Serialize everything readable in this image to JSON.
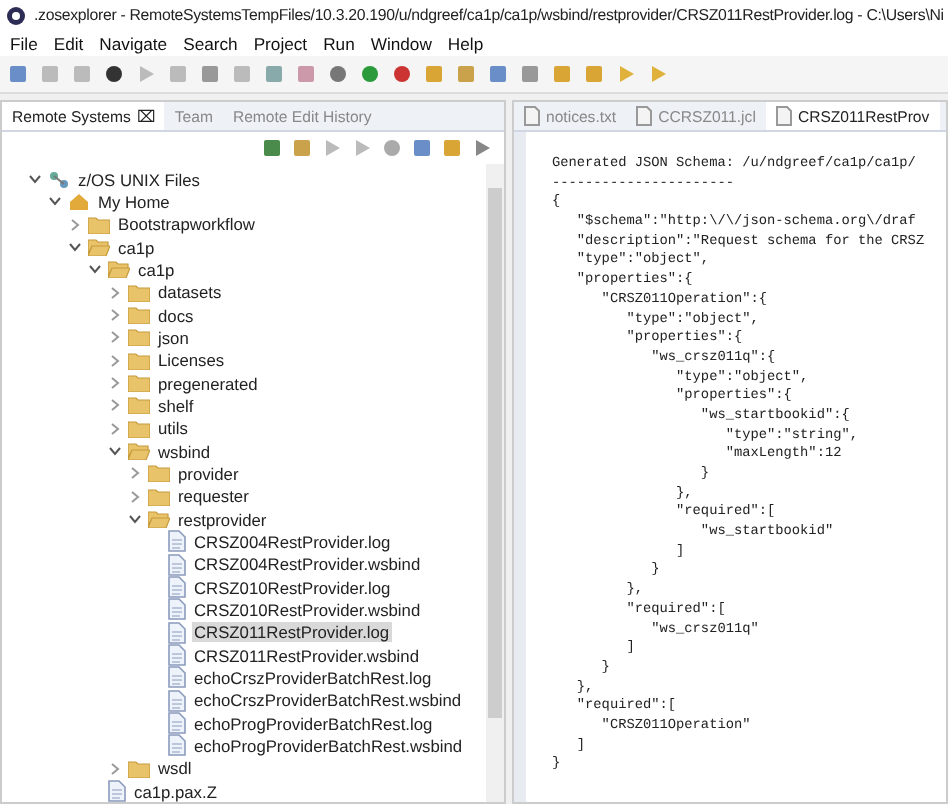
{
  "window": {
    "title": ".zosexplorer - RemoteSystemsTempFiles/10.3.20.190/u/ndgreef/ca1p/ca1p/wsbind/restprovider/CRSZ011RestProvider.log - C:\\Users\\Ni"
  },
  "menu": [
    "File",
    "Edit",
    "Navigate",
    "Search",
    "Project",
    "Run",
    "Window",
    "Help"
  ],
  "view_tabs": [
    {
      "label": "Remote Systems",
      "selected": true,
      "close": "⌧"
    },
    {
      "label": "Team",
      "selected": false
    },
    {
      "label": "Remote Edit History",
      "selected": false
    }
  ],
  "editor_tabs": [
    {
      "label": "notices.txt",
      "selected": false
    },
    {
      "label": "CCRSZ011.jcl",
      "selected": false
    },
    {
      "label": "CRSZ011RestProv",
      "selected": true
    }
  ],
  "tree": [
    {
      "label": "z/OS UNIX Files",
      "kind": "system",
      "expanded": true,
      "children": [
        {
          "label": "My Home",
          "kind": "home",
          "expanded": true,
          "children": [
            {
              "label": "Bootstrapworkflow",
              "kind": "folder",
              "expanded": false
            },
            {
              "label": "ca1p",
              "kind": "folder",
              "expanded": true,
              "children": [
                {
                  "label": "ca1p",
                  "kind": "folder",
                  "expanded": true,
                  "children": [
                    {
                      "label": "datasets",
                      "kind": "folder",
                      "expanded": false
                    },
                    {
                      "label": "docs",
                      "kind": "folder",
                      "expanded": false
                    },
                    {
                      "label": "json",
                      "kind": "folder",
                      "expanded": false
                    },
                    {
                      "label": "Licenses",
                      "kind": "folder",
                      "expanded": false
                    },
                    {
                      "label": "pregenerated",
                      "kind": "folder",
                      "expanded": false
                    },
                    {
                      "label": "shelf",
                      "kind": "folder",
                      "expanded": false
                    },
                    {
                      "label": "utils",
                      "kind": "folder",
                      "expanded": false
                    },
                    {
                      "label": "wsbind",
                      "kind": "folder",
                      "expanded": true,
                      "children": [
                        {
                          "label": "provider",
                          "kind": "folder",
                          "expanded": false
                        },
                        {
                          "label": "requester",
                          "kind": "folder",
                          "expanded": false
                        },
                        {
                          "label": "restprovider",
                          "kind": "folder",
                          "expanded": true,
                          "children": [
                            {
                              "label": "CRSZ004RestProvider.log",
                              "kind": "file",
                              "selected": false
                            },
                            {
                              "label": "CRSZ004RestProvider.wsbind",
                              "kind": "file",
                              "selected": false
                            },
                            {
                              "label": "CRSZ010RestProvider.log",
                              "kind": "file",
                              "selected": false
                            },
                            {
                              "label": "CRSZ010RestProvider.wsbind",
                              "kind": "file",
                              "selected": false
                            },
                            {
                              "label": "CRSZ011RestProvider.log",
                              "kind": "file",
                              "selected": true
                            },
                            {
                              "label": "CRSZ011RestProvider.wsbind",
                              "kind": "file",
                              "selected": false
                            },
                            {
                              "label": "echoCrszProviderBatchRest.log",
                              "kind": "file",
                              "selected": false
                            },
                            {
                              "label": "echoCrszProviderBatchRest.wsbind",
                              "kind": "file",
                              "selected": false
                            },
                            {
                              "label": "echoProgProviderBatchRest.log",
                              "kind": "file",
                              "selected": false
                            },
                            {
                              "label": "echoProgProviderBatchRest.wsbind",
                              "kind": "file",
                              "selected": false
                            }
                          ]
                        }
                      ]
                    },
                    {
                      "label": "wsdl",
                      "kind": "folder",
                      "expanded": false
                    }
                  ]
                },
                {
                  "label": "ca1p.pax.Z",
                  "kind": "file",
                  "selected": false
                }
              ]
            }
          ]
        }
      ]
    }
  ],
  "editor_lines": [
    "Generated JSON Schema: /u/ndgreef/ca1p/ca1p/",
    "----------------------",
    "{",
    "   \"$schema\":\"http:\\/\\/json-schema.org\\/draf",
    "   \"description\":\"Request schema for the CRSZ",
    "   \"type\":\"object\",",
    "   \"properties\":{",
    "      \"CRSZ011Operation\":{",
    "         \"type\":\"object\",",
    "         \"properties\":{",
    "            \"ws_crsz011q\":{",
    "               \"type\":\"object\",",
    "               \"properties\":{",
    "                  \"ws_startbookid\":{",
    "                     \"type\":\"string\",",
    "                     \"maxLength\":12",
    "                  }",
    "               },",
    "               \"required\":[",
    "                  \"ws_startbookid\"",
    "               ]",
    "            }",
    "         },",
    "         \"required\":[",
    "            \"ws_crsz011q\"",
    "         ]",
    "      }",
    "   },",
    "   \"required\":[",
    "      \"CRSZ011Operation\"",
    "   ]",
    "}"
  ]
}
